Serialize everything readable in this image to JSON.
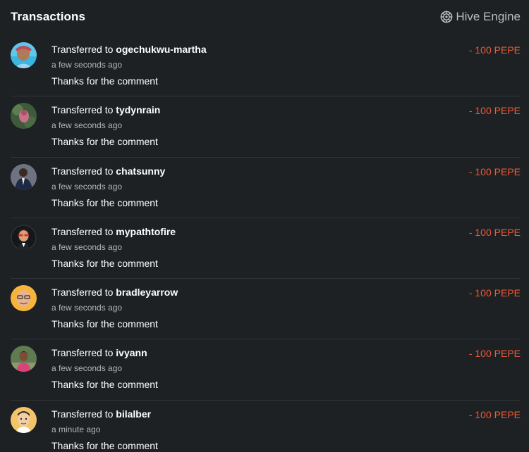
{
  "header": {
    "title": "Transactions",
    "brand_label": "Hive Engine",
    "brand_icon": "hive-engine-logo-icon"
  },
  "transactions": [
    {
      "prefix": "Transferred to ",
      "recipient": "ogechukwu-martha",
      "time": "a few seconds ago",
      "memo": "Thanks for the comment",
      "amount": "- 100 PEPE",
      "avatar": "user-avatar"
    },
    {
      "prefix": "Transferred to ",
      "recipient": "tydynrain",
      "time": "a few seconds ago",
      "memo": "Thanks for the comment",
      "amount": "- 100 PEPE",
      "avatar": "user-avatar"
    },
    {
      "prefix": "Transferred to ",
      "recipient": "chatsunny",
      "time": "a few seconds ago",
      "memo": "Thanks for the comment",
      "amount": "- 100 PEPE",
      "avatar": "user-avatar"
    },
    {
      "prefix": "Transferred to ",
      "recipient": "mypathtofire",
      "time": "a few seconds ago",
      "memo": "Thanks for the comment",
      "amount": "- 100 PEPE",
      "avatar": "user-avatar"
    },
    {
      "prefix": "Transferred to ",
      "recipient": "bradleyarrow",
      "time": "a few seconds ago",
      "memo": "Thanks for the comment",
      "amount": "- 100 PEPE",
      "avatar": "user-avatar"
    },
    {
      "prefix": "Transferred to ",
      "recipient": "ivyann",
      "time": "a few seconds ago",
      "memo": "Thanks for the comment",
      "amount": "- 100 PEPE",
      "avatar": "user-avatar"
    },
    {
      "prefix": "Transferred to ",
      "recipient": "bilalber",
      "time": "a minute ago",
      "memo": "Thanks for the comment",
      "amount": "- 100 PEPE",
      "avatar": "user-avatar"
    }
  ],
  "colors": {
    "background": "#1e2124",
    "amount_negative": "#ea5a35",
    "divider": "#2f3337",
    "muted_text": "#b3b6b9"
  }
}
